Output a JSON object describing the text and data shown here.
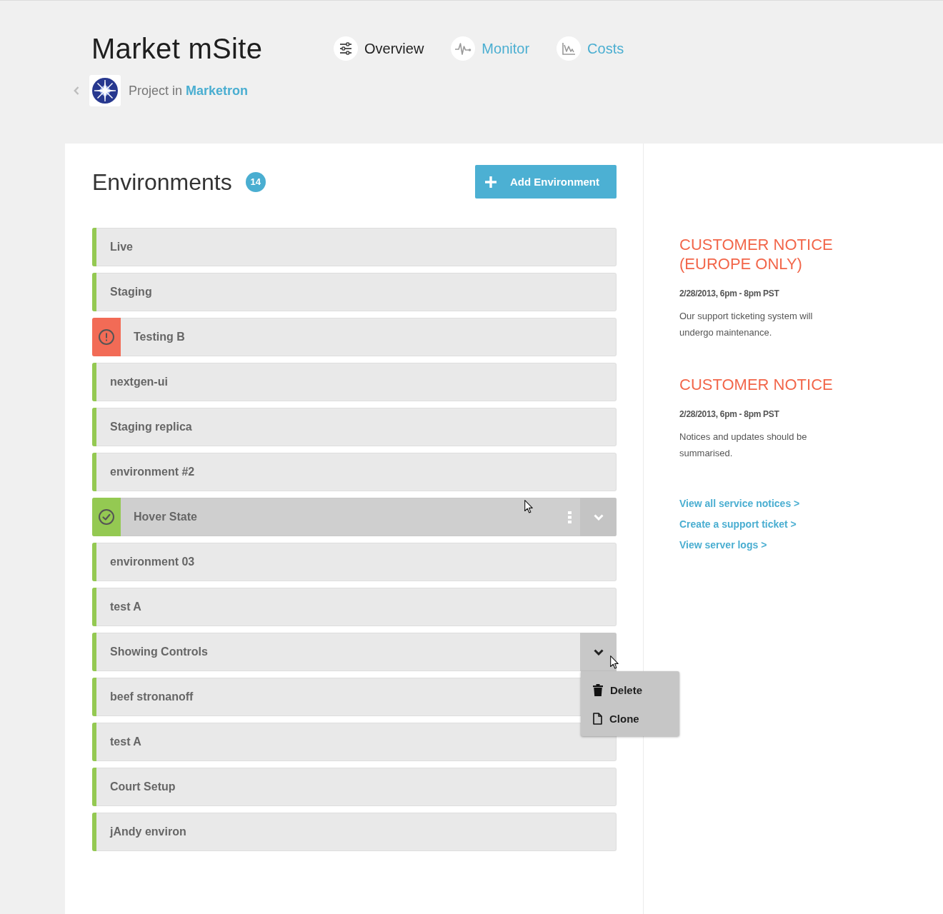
{
  "header": {
    "title": "Market mSite",
    "nav": [
      {
        "label": "Overview",
        "kind": "sliders",
        "selected": true
      },
      {
        "label": "Monitor",
        "kind": "pulse",
        "selected": false
      },
      {
        "label": "Costs",
        "kind": "chart",
        "selected": false
      }
    ],
    "breadcrumb": {
      "prefix": "Project in",
      "project": "Marketron"
    }
  },
  "environments": {
    "title": "Environments",
    "count": "14",
    "add_button": "Add Environment",
    "rows": [
      {
        "name": "Live",
        "error": false,
        "hovered": false,
        "expanded": false
      },
      {
        "name": "Staging",
        "error": false,
        "hovered": false,
        "expanded": false
      },
      {
        "name": "Testing B",
        "error": true,
        "hovered": false,
        "expanded": false
      },
      {
        "name": "nextgen-ui",
        "error": false,
        "hovered": false,
        "expanded": false
      },
      {
        "name": "Staging replica",
        "error": false,
        "hovered": false,
        "expanded": false
      },
      {
        "name": "environment #2",
        "error": false,
        "hovered": false,
        "expanded": false
      },
      {
        "name": "Hover State",
        "error": false,
        "hovered": true,
        "expanded": false
      },
      {
        "name": "environment 03",
        "error": false,
        "hovered": false,
        "expanded": false
      },
      {
        "name": "test A",
        "error": false,
        "hovered": false,
        "expanded": false
      },
      {
        "name": "Showing Controls",
        "error": false,
        "hovered": false,
        "expanded": true,
        "menu": [
          {
            "label": "Delete",
            "kind": "delete"
          },
          {
            "label": "Clone",
            "kind": "clone"
          }
        ]
      },
      {
        "name": "beef stronanoff",
        "error": false,
        "hovered": false,
        "expanded": false
      },
      {
        "name": "test A",
        "error": false,
        "hovered": false,
        "expanded": false
      },
      {
        "name": "Court Setup",
        "error": false,
        "hovered": false,
        "expanded": false
      },
      {
        "name": "jAndy environ",
        "error": false,
        "hovered": false,
        "expanded": false
      }
    ]
  },
  "sidebar": {
    "notices": [
      {
        "title": "CUSTOMER NOTICE (EUROPE ONLY)",
        "date": "2/28/2013, 6pm - 8pm PST",
        "body": "Our support ticketing system will undergo maintenance."
      },
      {
        "title": "CUSTOMER NOTICE",
        "date": "2/28/2013, 6pm - 8pm PST",
        "body": "Notices and updates should be summarised."
      }
    ],
    "links": [
      "View all service notices >",
      "Create a support ticket >",
      "View server logs >"
    ]
  }
}
